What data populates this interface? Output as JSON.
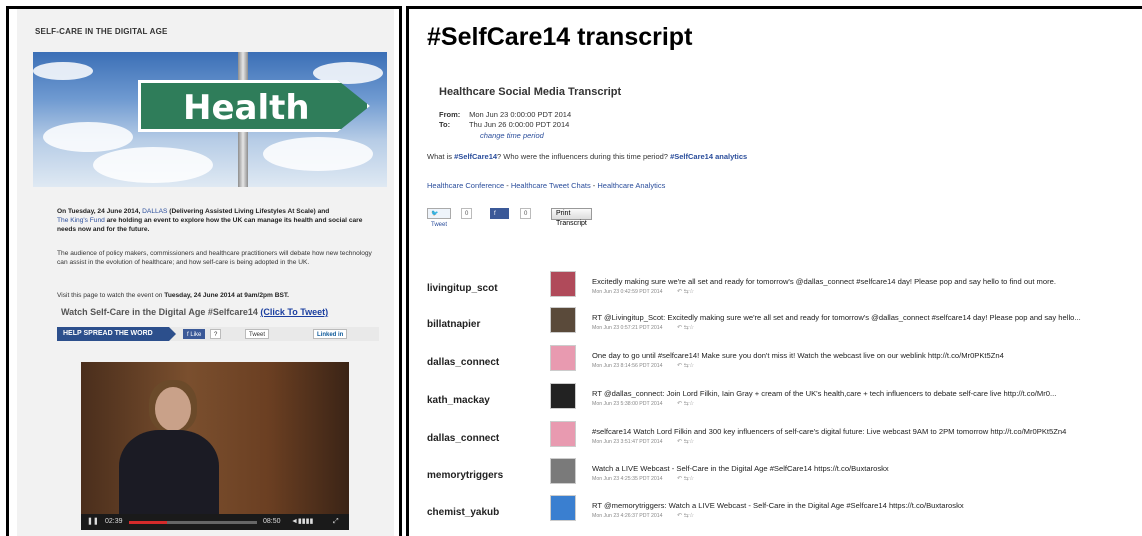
{
  "left": {
    "page_title": "SELF-CARE IN THE DIGITAL AGE",
    "hero_sign": "Health",
    "para1_a": "On Tuesday, 24 June 2014, ",
    "para1_dallas": "DALLAS",
    "para1_b": " (Delivering Assisted Living Lifestyles At Scale) and",
    "para1_kings": "The King's Fund",
    "para1_c": " are holding an event to explore how the UK can manage its health and social care needs now and for the future.",
    "para2": "The audience of policy makers, commissioners and healthcare practitioners will debate how new technology can assist in the evolution of healthcare; and how self-care is being adopted in the UK.",
    "para3_a": "Visit this page to watch the event on ",
    "para3_b": "Tuesday, 24 June 2014 at 9am/2pm BST.",
    "watch": "Watch Self-Care in the Digital Age #Selfcare14",
    "click_to_tweet": "(Click To Tweet)",
    "share": {
      "spread": "HELP SPREAD THE WORD",
      "fb": "f Like",
      "fb_count": "?",
      "tweet": "Tweet",
      "linkedin": "Linked in"
    },
    "video": {
      "time_current": "02:39",
      "time_total": "08:50",
      "progress": 0.3
    }
  },
  "right": {
    "title": "#SelfCare14 transcript",
    "subtitle": "Healthcare Social Media Transcript",
    "from_label": "From:",
    "from_value": "Mon Jun 23 0:00:00 PDT 2014",
    "to_label": "To:",
    "to_value": "Thu Jun 26 0:00:00 PDT 2014",
    "change_period": "change time period",
    "question_a": "What is ",
    "question_tag": "#SelfCare14",
    "question_b": "? Who were the influencers during this time period? ",
    "question_analytics": "#SelfCare14 analytics",
    "links": [
      "Healthcare Conference",
      "Healthcare Tweet Chats",
      "Healthcare Analytics"
    ],
    "link_sep": " - ",
    "tweet_btn": "Tweet",
    "tweet_count": "0",
    "like_btn": "Like",
    "like_count": "0",
    "print_btn": "Print Transcript",
    "tweets": [
      {
        "user": "livingitup_scot",
        "text": "Excitedly making sure we're all set and ready for tomorrow's @dallas_connect #selfcare14 day! Please pop and say hello to find out more.",
        "date": "Mon Jun 23 0:42:59 PDT 2014",
        "avatar_color": "#b04a5a"
      },
      {
        "user": "billatnapier",
        "text": "RT @Livingitup_Scot: Excitedly making sure we're all set and ready for tomorrow's @dallas_connect #selfcare14 day! Please pop and say hello...",
        "date": "Mon Jun 23 0:57:21 PDT 2014",
        "avatar_color": "#5a4a3a"
      },
      {
        "user": "dallas_connect",
        "text": "One day to go until #selfcare14! Make sure you don't miss it! Watch the webcast live on our weblink http://t.co/Mr0PKt5Zn4",
        "date": "Mon Jun 23 8:14:56 PDT 2014",
        "avatar_color": "#e89ab0"
      },
      {
        "user": "kath_mackay",
        "text": "RT @dallas_connect: Join Lord Filkin, Iain Gray + cream of the UK's health,care + tech influencers to debate self-care live http://t.co/Mr0...",
        "date": "Mon Jun 23 5:38:00 PDT 2014",
        "avatar_color": "#222222"
      },
      {
        "user": "dallas_connect",
        "text": "#selfcare14 Watch Lord Filkin and 300 key influencers of self-care's digital future: Live webcast 9AM to 2PM tomorrow http://t.co/Mr0PKt5Zn4",
        "date": "Mon Jun 23 3:51:47 PDT 2014",
        "avatar_color": "#e89ab0"
      },
      {
        "user": "memorytriggers",
        "text": "Watch a LIVE Webcast - Self-Care in the Digital Age #SelfCare14 https://t.co/Buxtaroskx",
        "date": "Mon Jun 23 4:25:35 PDT 2014",
        "avatar_color": "#7a7a7a"
      },
      {
        "user": "chemist_yakub",
        "text": "RT @memorytriggers: Watch a LIVE Webcast - Self-Care in the Digital Age #Selfcare14 https://t.co/Buxtaroskx",
        "date": "Mon Jun 23 4:26:37 PDT 2014",
        "avatar_color": "#3a7fd0"
      }
    ]
  }
}
